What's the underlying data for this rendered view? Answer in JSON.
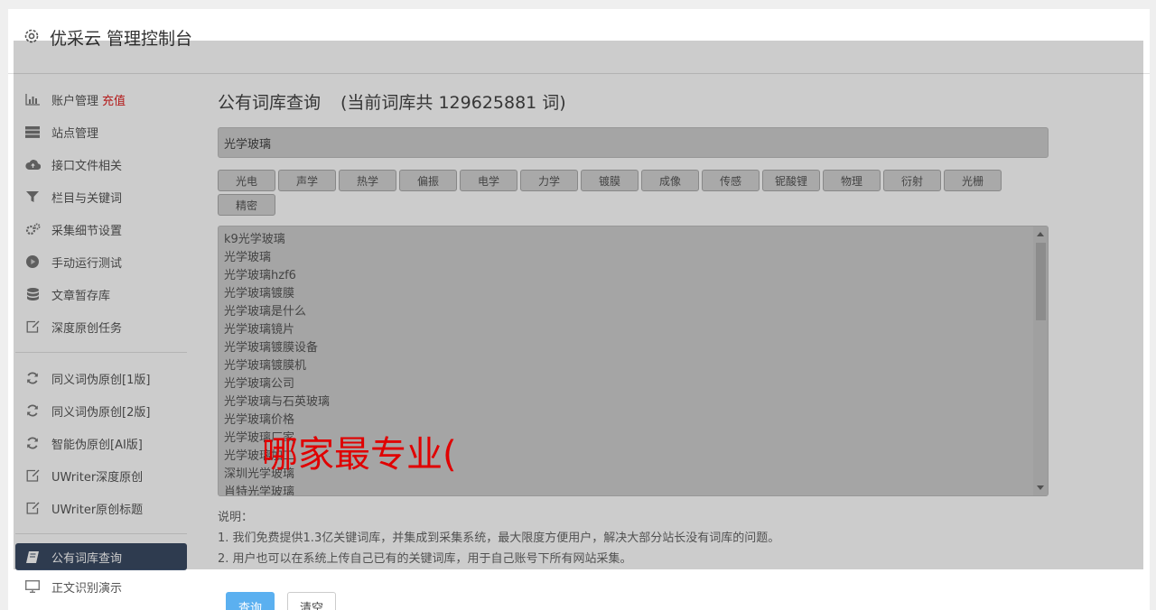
{
  "header": {
    "title": "优采云 管理控制台",
    "icon": "gear-icon"
  },
  "sidebar": {
    "group1": [
      {
        "label": "账户管理",
        "badge": "充值",
        "icon": "bar-chart-icon"
      },
      {
        "label": "站点管理",
        "icon": "server-icon"
      },
      {
        "label": "接口文件相关",
        "icon": "cloud-upload-icon"
      },
      {
        "label": "栏目与关键词",
        "icon": "filter-icon"
      },
      {
        "label": "采集细节设置",
        "icon": "cogs-icon"
      },
      {
        "label": "手动运行测试",
        "icon": "play-circle-icon"
      },
      {
        "label": "文章暂存库",
        "icon": "database-icon"
      },
      {
        "label": "深度原创任务",
        "icon": "edit-icon"
      }
    ],
    "group2": [
      {
        "label": "同义词伪原创[1版]",
        "icon": "refresh-icon"
      },
      {
        "label": "同义词伪原创[2版]",
        "icon": "refresh-icon"
      },
      {
        "label": "智能伪原创[AI版]",
        "icon": "refresh-icon"
      },
      {
        "label": "UWriter深度原创",
        "icon": "edit-icon"
      },
      {
        "label": "UWriter原创标题",
        "icon": "edit-icon"
      }
    ],
    "group3": [
      {
        "label": "公有词库查询",
        "icon": "book-icon",
        "active": true
      },
      {
        "label": "正文识别演示",
        "icon": "monitor-icon"
      }
    ]
  },
  "main": {
    "title": "公有词库查询",
    "count_text": "(当前词库共 129625881 词)",
    "search_value": "光学玻璃",
    "tags": [
      "光电",
      "声学",
      "热学",
      "偏振",
      "电学",
      "力学",
      "镀膜",
      "成像",
      "传感",
      "铌酸锂",
      "物理",
      "衍射",
      "光栅",
      "精密"
    ],
    "results": [
      "k9光学玻璃",
      "光学玻璃",
      "光学玻璃hzf6",
      "光学玻璃镀膜",
      "光学玻璃是什么",
      "光学玻璃镜片",
      "光学玻璃镀膜设备",
      "光学玻璃镀膜机",
      "光学玻璃公司",
      "光学玻璃与石英玻璃",
      "光学玻璃价格",
      "光学玻璃厂家",
      "光学玻璃加工",
      "深圳光学玻璃",
      "肖特光学玻璃"
    ],
    "overlay_text": "哪家最专业(",
    "notes_title": "说明：",
    "notes": [
      "1. 我们免费提供1.3亿关键词库，并集成到采集系统，最大限度方便用户，解决大部分站长没有词库的问题。",
      "2. 用户也可以在系统上传自己已有的关键词库，用于自己账号下所有网站采集。"
    ],
    "query_button": "查询",
    "clear_button": "清空"
  },
  "colors": {
    "accent": "#3a4a63",
    "primary_button": "#5bb0f0",
    "badge": "#e02020",
    "overlay_text": "#e00000"
  }
}
